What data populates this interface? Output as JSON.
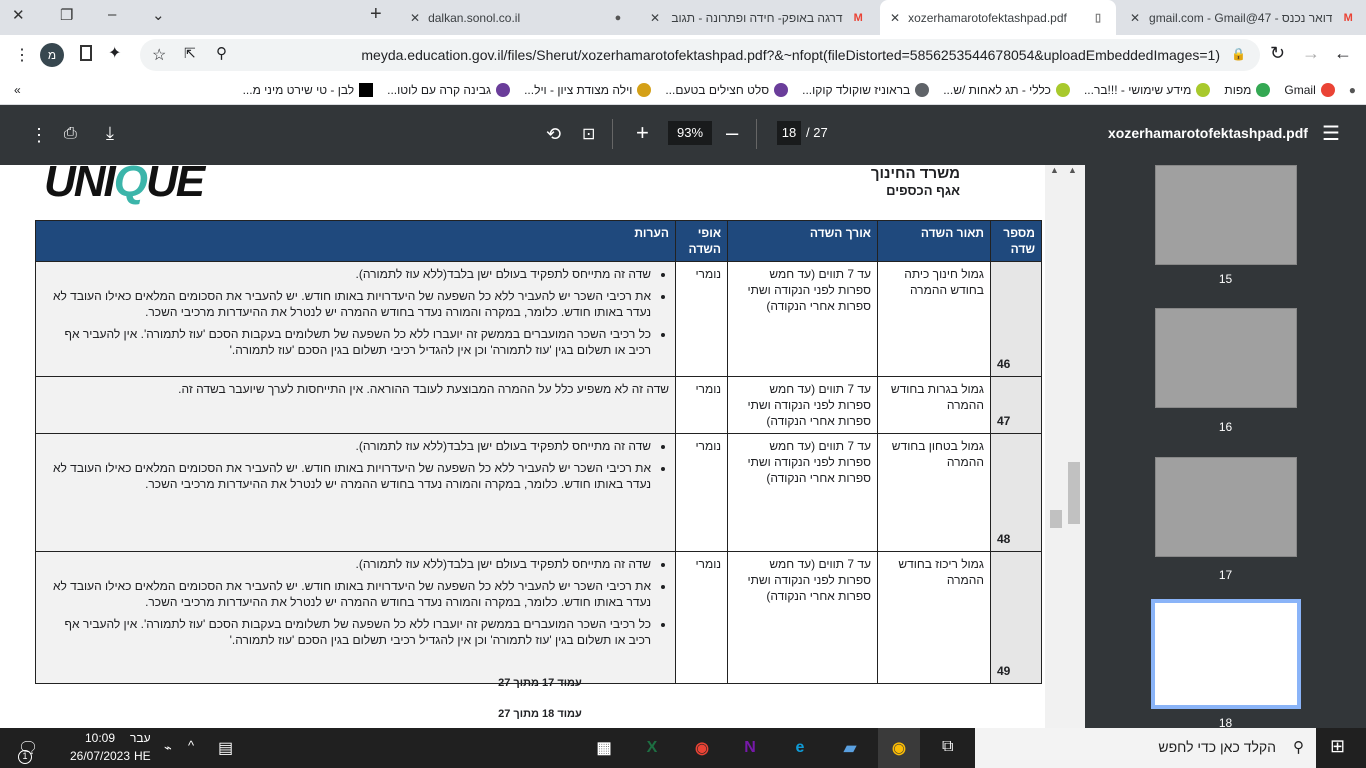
{
  "browser": {
    "tabs": [
      {
        "title": "דואר נכנס - 47@gmail.com - Gmail",
        "icon": "gmail-icon",
        "active": false
      },
      {
        "title": "xozerhamarotofektashpad.pdf",
        "icon": "document-icon",
        "active": true
      },
      {
        "title": "דרגה באופק- חידה ופתרונה - תגוב",
        "icon": "gmail-icon",
        "active": false
      },
      {
        "title": "dalkan.sonol.co.il",
        "icon": "globe-icon",
        "active": false
      }
    ],
    "new_tab": "+",
    "url": "meyda.education.gov.il/files/Sherut/xozerhamarotofektashpad.pdf?&~nfopt(fileDistorted=5856253544678054&uploadEmbeddedImages=1)",
    "profile_initial": "מ",
    "bookmarks": [
      {
        "label": "Gmail",
        "color": "#ea4335"
      },
      {
        "label": "מפות",
        "color": "#34a853"
      },
      {
        "label": "מידע שימושי - !!!בר...",
        "color": "#a8c92c"
      },
      {
        "label": "כללי - תג לאחות /ש...",
        "color": "#a8c92c"
      },
      {
        "label": "בראוניז שוקולד קוקו...",
        "color": "#5f6368"
      },
      {
        "label": "סלט חצילים בטעם...",
        "color": "#6a3d9a"
      },
      {
        "label": "וילה מצודת ציון - ויל...",
        "color": "#d4a017"
      },
      {
        "label": "גבינה קרה עם לוטו...",
        "color": "#6a3d9a"
      },
      {
        "label": "לבן - טי שירט מיני מ...",
        "color": "#000000"
      }
    ],
    "more_bookmarks": "»"
  },
  "pdf": {
    "filename": "xozerhamarotofektashpad.pdf",
    "zoom": "93%",
    "page_current": "18",
    "page_total": "/ 27",
    "header": {
      "logo": "unique",
      "ministry": "משרד   החינוך",
      "department": "אגף הכספים"
    },
    "table": {
      "headers": [
        "מספר שדה",
        "תאור השדה",
        "אורך השדה",
        "אופי השדה",
        "הערות"
      ],
      "rows": [
        {
          "number": "46",
          "description": "גמול חינוך כיתה בחודש ההמרה",
          "length": "עד 7 תווים (עד חמש ספרות לפני הנקודה ושתי ספרות אחרי הנקודה)",
          "type": "נומרי",
          "notes": [
            "שדה זה מתייחס לתפקיד בעולם ישן בלבד(ללא עוז לתמורה).",
            "את רכיבי השכר יש להעביר ללא כל השפעה של היעדרויות באותו חודש. יש להעביר את הסכומים המלאים כאילו העובד לא נעדר באותו חודש.  כלומר, במקרה והמורה נעדר בחודש ההמרה יש לנטרל את ההיעדרות מרכיבי השכר.",
            "כל רכיבי השכר המועברים בממשק זה יועברו ללא כל השפעה של תשלומים בעקבות הסכם 'עוז לתמורה'. אין להעביר אף רכיב או תשלום בגין 'עוז לתמורה' וכן אין להגדיל רכיבי תשלום בגין הסכם 'עוז לתמורה.'"
          ]
        },
        {
          "number": "47",
          "description": "גמול בגרות בחודש ההמרה",
          "length": "עד 7 תווים (עד חמש ספרות לפני הנקודה ושתי ספרות אחרי הנקודה)",
          "type": "נומרי",
          "notes": [
            "שדה זה לא משפיע כלל על ההמרה המבוצעת לעובד ההוראה. אין התייחסות לערך שיועבר בשדה זה."
          ]
        },
        {
          "number": "48",
          "description": "גמול בטחון בחודש ההמרה",
          "length": "עד 7 תווים (עד חמש ספרות לפני הנקודה ושתי ספרות אחרי הנקודה)",
          "type": "נומרי",
          "notes": [
            "שדה זה מתייחס לתפקיד בעולם ישן בלבד(ללא עוז לתמורה).",
            "את רכיבי השכר יש להעביר ללא כל השפעה של היעדרויות באותו חודש. יש להעביר את הסכומים המלאים כאילו העובד לא נעדר באותו חודש.  כלומר, במקרה והמורה נעדר בחודש ההמרה יש לנטרל את ההיעדרות מרכיבי השכר."
          ]
        },
        {
          "number": "49",
          "description": "גמול ריכוז בחודש ההמרה",
          "length": "עד 7 תווים (עד חמש ספרות לפני הנקודה ושתי ספרות אחרי הנקודה)",
          "type": "נומרי",
          "notes": [
            "שדה זה מתייחס לתפקיד בעולם ישן בלבד(ללא עוז לתמורה).",
            "את רכיבי השכר יש להעביר ללא כל השפעה של היעדרויות באותו חודש. יש להעביר את הסכומים המלאים כאילו העובד לא נעדר באותו חודש.  כלומר, במקרה והמורה נעדר בחודש ההמרה יש לנטרל את ההיעדרות מרכיבי השכר.",
            "כל רכיבי השכר המועברים בממשק זה יועברו ללא כל השפעה של תשלומים בעקבות הסכם 'עוז לתמורה'. אין להעביר אף רכיב או תשלום בגין 'עוז לתמורה' וכן אין להגדיל רכיבי תשלום בגין הסכם 'עוז לתמורה.'"
          ]
        }
      ]
    },
    "footer_page_17": "עמוד 17 מתוך 27",
    "footer_page_18": "עמוד 18 מתוך 27",
    "thumbnails": [
      "15",
      "16",
      "17",
      "18"
    ],
    "selected_thumbnail": "18"
  },
  "taskbar": {
    "search_placeholder": "הקלד כאן כדי לחפש",
    "time": "10:09",
    "date": "26/07/2023",
    "language": "עבר",
    "language_code": "HE",
    "notification_count": "1",
    "apps": [
      "calculator",
      "excel",
      "chrome",
      "onenote",
      "edge",
      "file-manager",
      "chrome-profile"
    ]
  }
}
